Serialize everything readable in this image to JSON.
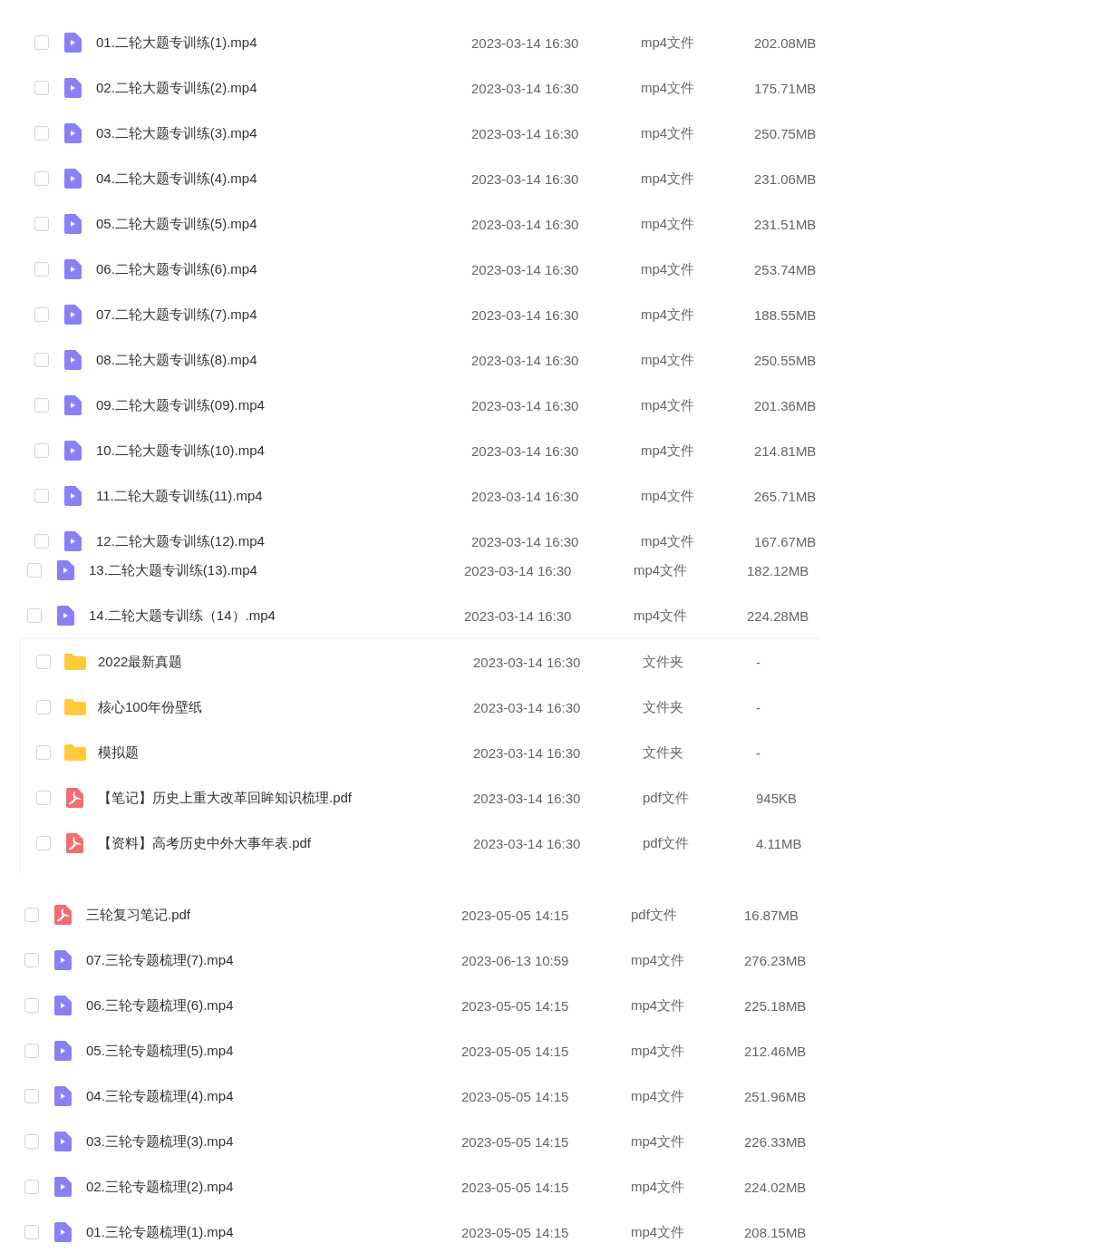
{
  "sections": [
    {
      "rows": [
        {
          "kind": "video",
          "name": "01.二轮大题专训练(1).mp4",
          "date": "2023-03-14 16:30",
          "type": "mp4文件",
          "size": "202.08MB",
          "selected": false
        },
        {
          "kind": "video",
          "name": "02.二轮大题专训练(2).mp4",
          "date": "2023-03-14 16:30",
          "type": "mp4文件",
          "size": "175.71MB",
          "selected": false
        },
        {
          "kind": "video",
          "name": "03.二轮大题专训练(3).mp4",
          "date": "2023-03-14 16:30",
          "type": "mp4文件",
          "size": "250.75MB",
          "selected": false
        },
        {
          "kind": "video",
          "name": "04.二轮大题专训练(4).mp4",
          "date": "2023-03-14 16:30",
          "type": "mp4文件",
          "size": "231.06MB",
          "selected": false
        },
        {
          "kind": "video",
          "name": "05.二轮大题专训练(5).mp4",
          "date": "2023-03-14 16:30",
          "type": "mp4文件",
          "size": "231.51MB",
          "selected": false
        },
        {
          "kind": "video",
          "name": "06.二轮大题专训练(6).mp4",
          "date": "2023-03-14 16:30",
          "type": "mp4文件",
          "size": "253.74MB",
          "selected": false
        },
        {
          "kind": "video",
          "name": "07.二轮大题专训练(7).mp4",
          "date": "2023-03-14 16:30",
          "type": "mp4文件",
          "size": "188.55MB",
          "selected": false
        },
        {
          "kind": "video",
          "name": "08.二轮大题专训练(8).mp4",
          "date": "2023-03-14 16:30",
          "type": "mp4文件",
          "size": "250.55MB",
          "selected": false
        },
        {
          "kind": "video",
          "name": "09.二轮大题专训练(09).mp4",
          "date": "2023-03-14 16:30",
          "type": "mp4文件",
          "size": "201.36MB",
          "selected": false
        },
        {
          "kind": "video",
          "name": "10.二轮大题专训练(10).mp4",
          "date": "2023-03-14 16:30",
          "type": "mp4文件",
          "size": "214.81MB",
          "selected": false
        },
        {
          "kind": "video",
          "name": "11.二轮大题专训练(11).mp4",
          "date": "2023-03-14 16:30",
          "type": "mp4文件",
          "size": "265.71MB",
          "selected": false
        },
        {
          "kind": "video",
          "name": "12.二轮大题专训练(12).mp4",
          "date": "2023-03-14 16:30",
          "type": "mp4文件",
          "size": "167.67MB",
          "selected": false
        }
      ]
    },
    {
      "rows": [
        {
          "kind": "video",
          "name": "13.二轮大题专训练(13).mp4",
          "date": "2023-03-14 16:30",
          "type": "mp4文件",
          "size": "182.12MB",
          "selected": false
        },
        {
          "kind": "video",
          "name": "14.二轮大题专训练（14）.mp4",
          "date": "2023-03-14 16:30",
          "type": "mp4文件",
          "size": "224.28MB",
          "selected": false
        }
      ]
    },
    {
      "rows": [
        {
          "kind": "folder",
          "name": "2022最新真题",
          "date": "2023-03-14 16:30",
          "type": "文件夹",
          "size": "-",
          "selected": false
        },
        {
          "kind": "folder",
          "name": "核心100年份壁纸",
          "date": "2023-03-14 16:30",
          "type": "文件夹",
          "size": "-",
          "selected": false
        },
        {
          "kind": "folder",
          "name": "模拟题",
          "date": "2023-03-14 16:30",
          "type": "文件夹",
          "size": "-",
          "selected": false
        },
        {
          "kind": "pdf",
          "name": "【笔记】历史上重大改革回眸知识梳理.pdf",
          "date": "2023-03-14 16:30",
          "type": "pdf文件",
          "size": "945KB",
          "selected": false
        },
        {
          "kind": "pdf",
          "name": "【资料】高考历史中外大事年表.pdf",
          "date": "2023-03-14 16:30",
          "type": "pdf文件",
          "size": "4.11MB",
          "selected": false
        }
      ]
    },
    {
      "rows": [
        {
          "kind": "pdf",
          "name": "三轮复习笔记.pdf",
          "date": "2023-05-05 14:15",
          "type": "pdf文件",
          "size": "16.87MB",
          "selected": false
        },
        {
          "kind": "video",
          "name": "07.三轮专题梳理(7).mp4",
          "date": "2023-06-13 10:59",
          "type": "mp4文件",
          "size": "276.23MB",
          "selected": false
        },
        {
          "kind": "video",
          "name": "06.三轮专题梳理(6).mp4",
          "date": "2023-05-05 14:15",
          "type": "mp4文件",
          "size": "225.18MB",
          "selected": false
        },
        {
          "kind": "video",
          "name": "05.三轮专题梳理(5).mp4",
          "date": "2023-05-05 14:15",
          "type": "mp4文件",
          "size": "212.46MB",
          "selected": false
        },
        {
          "kind": "video",
          "name": "04.三轮专题梳理(4).mp4",
          "date": "2023-05-05 14:15",
          "type": "mp4文件",
          "size": "251.96MB",
          "selected": false
        },
        {
          "kind": "video",
          "name": "03.三轮专题梳理(3).mp4",
          "date": "2023-05-05 14:15",
          "type": "mp4文件",
          "size": "226.33MB",
          "selected": false
        },
        {
          "kind": "video",
          "name": "02.三轮专题梳理(2).mp4",
          "date": "2023-05-05 14:15",
          "type": "mp4文件",
          "size": "224.02MB",
          "selected": false
        },
        {
          "kind": "video",
          "name": "01.三轮专题梳理(1).mp4",
          "date": "2023-05-05 14:15",
          "type": "mp4文件",
          "size": "208.15MB",
          "selected": false
        }
      ]
    }
  ]
}
